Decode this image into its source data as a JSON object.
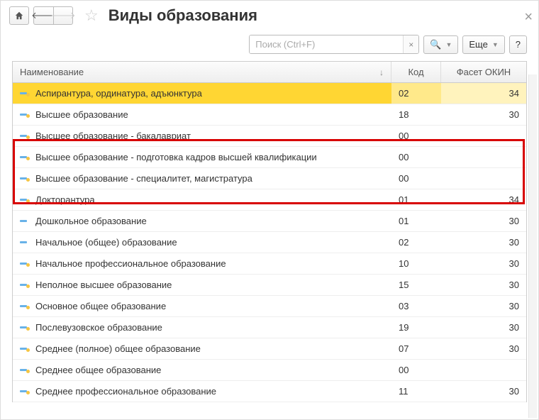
{
  "header": {
    "title": "Виды образования"
  },
  "toolbar": {
    "search_placeholder": "Поиск (Ctrl+F)",
    "more_label": "Еще",
    "help_label": "?"
  },
  "table": {
    "columns": {
      "name": "Наименование",
      "code": "Код",
      "facet": "Фасет ОКИН"
    },
    "rows": [
      {
        "name": "Аспирантура, ординатура, адъюнктура",
        "code": "02",
        "facet": "34",
        "selected": true,
        "key": true
      },
      {
        "name": "Высшее образование",
        "code": "18",
        "facet": "30",
        "key": true
      },
      {
        "name": "Высшее образование - бакалавриат",
        "code": "00",
        "facet": "",
        "key": true
      },
      {
        "name": "Высшее образование - подготовка кадров высшей квалификации",
        "code": "00",
        "facet": "",
        "key": true
      },
      {
        "name": "Высшее образование - специалитет, магистратура",
        "code": "00",
        "facet": "",
        "key": true
      },
      {
        "name": "Докторантура",
        "code": "01",
        "facet": "34",
        "key": true
      },
      {
        "name": "Дошкольное образование",
        "code": "01",
        "facet": "30",
        "key": false
      },
      {
        "name": "Начальное (общее) образование",
        "code": "02",
        "facet": "30",
        "key": false
      },
      {
        "name": "Начальное профессиональное образование",
        "code": "10",
        "facet": "30",
        "key": true
      },
      {
        "name": "Неполное высшее образование",
        "code": "15",
        "facet": "30",
        "key": true
      },
      {
        "name": "Основное общее образование",
        "code": "03",
        "facet": "30",
        "key": true
      },
      {
        "name": "Послевузовское образование",
        "code": "19",
        "facet": "30",
        "key": true
      },
      {
        "name": "Среднее (полное) общее образование",
        "code": "07",
        "facet": "30",
        "key": true
      },
      {
        "name": "Среднее общее образование",
        "code": "00",
        "facet": "",
        "key": true
      },
      {
        "name": "Среднее профессиональное образование",
        "code": "11",
        "facet": "30",
        "key": true
      }
    ]
  }
}
